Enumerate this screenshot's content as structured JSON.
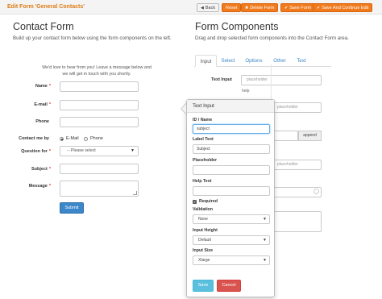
{
  "topbar": {
    "heading": "Edit Form 'General Contacts'",
    "buttons": {
      "back": "Back",
      "reset": "Reset",
      "delete": "Delete Form",
      "save": "Save Form",
      "save_continue": "Save And Continue Edit"
    }
  },
  "left": {
    "title": "Contact Form",
    "subtitle": "Build up your contact form below using the form components on the left.",
    "intro_line1": "We'd love to hear from you! Leave a message below and",
    "intro_line2": "we will get in touch with you shortly.",
    "fields": {
      "name_label": "Name",
      "email_label": "E-mail",
      "phone_label": "Phone",
      "contact_by_label": "Contact me by",
      "radio_email": "E-Mail",
      "radio_phone": "Phone",
      "question_label": "Question for",
      "question_selected": "-- Please select",
      "subject_label": "Subject",
      "message_label": "Message",
      "required_mark": "*"
    },
    "submit_label": "Submit"
  },
  "right": {
    "title": "Form Components",
    "subtitle": "Drag and drop selected form components into the Contact Form area.",
    "tabs": [
      "Input",
      "Select",
      "Options",
      "Other",
      "Text"
    ],
    "text_input_label": "Text Input",
    "placeholder1": "placeholder",
    "help": "help",
    "placeholder2": "placeholder",
    "append": "append",
    "placeholder3": "placeholder"
  },
  "popover": {
    "title": "Text Input",
    "id_label": "ID / Name",
    "id_value": "subject",
    "label_text_label": "Label Text",
    "label_text_value": "Subject",
    "placeholder_label": "Placeholder",
    "placeholder_value": "",
    "help_text_label": "Help Text",
    "help_text_value": "",
    "required_label": "Required",
    "validation_label": "Validation",
    "validation_value": "None",
    "input_height_label": "Input Height",
    "input_height_value": "Default",
    "input_size_label": "Input Size",
    "input_size_value": "Xlarge",
    "save_label": "Save",
    "cancel_label": "Cancel"
  },
  "colors": {
    "accent_orange": "#f07a1e",
    "heading_orange": "#e07b14",
    "primary_blue": "#3b87c9",
    "save_cyan": "#5bc0de",
    "cancel_red": "#d9534f"
  }
}
